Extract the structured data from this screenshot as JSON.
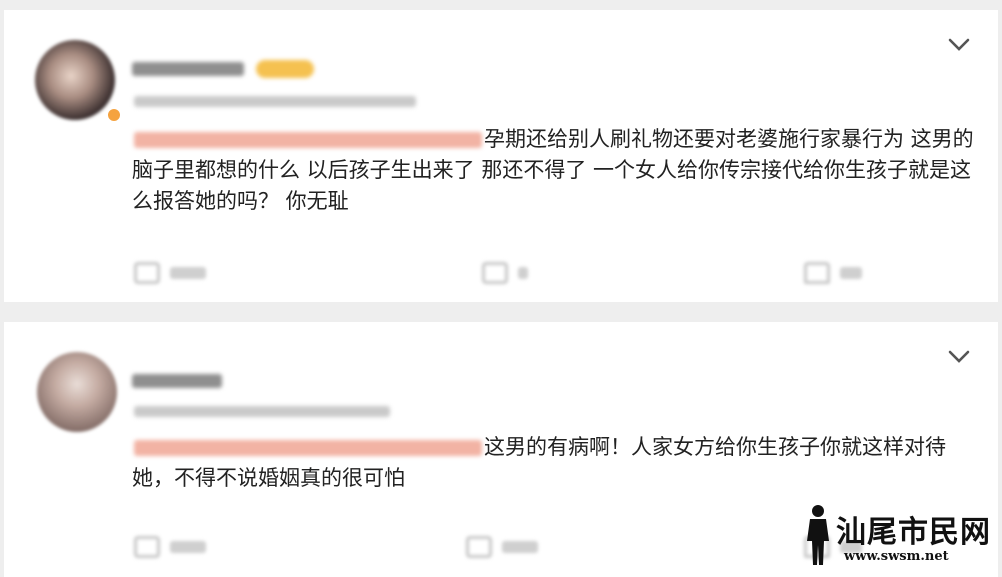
{
  "comments": [
    {
      "username": "",
      "meta": "",
      "topic_tag": "",
      "text": "孕期还给别人刷礼物还要对老婆施行家暴行为 这男的脑子里都想的什么 以后孩子生出来了 那还不得了 一个女人给你传宗接代给你生孩子就是这么报答她的吗？ 你无耻",
      "actions": {
        "share": "",
        "comment": "",
        "like": ""
      }
    },
    {
      "username": "",
      "meta": "",
      "topic_tag": "",
      "text": "这男的有病啊！人家女方给你生孩子你就这样对待她，不得不说婚姻真的很可怕",
      "actions": {
        "share": "",
        "comment": "",
        "like": ""
      }
    }
  ],
  "watermark": {
    "text": "汕尾市民网",
    "url": "www.swsm.net"
  },
  "colors": {
    "background": "#eeeeee",
    "card": "#ffffff",
    "text": "#222222",
    "topic_tag": "#f2b3a4"
  }
}
